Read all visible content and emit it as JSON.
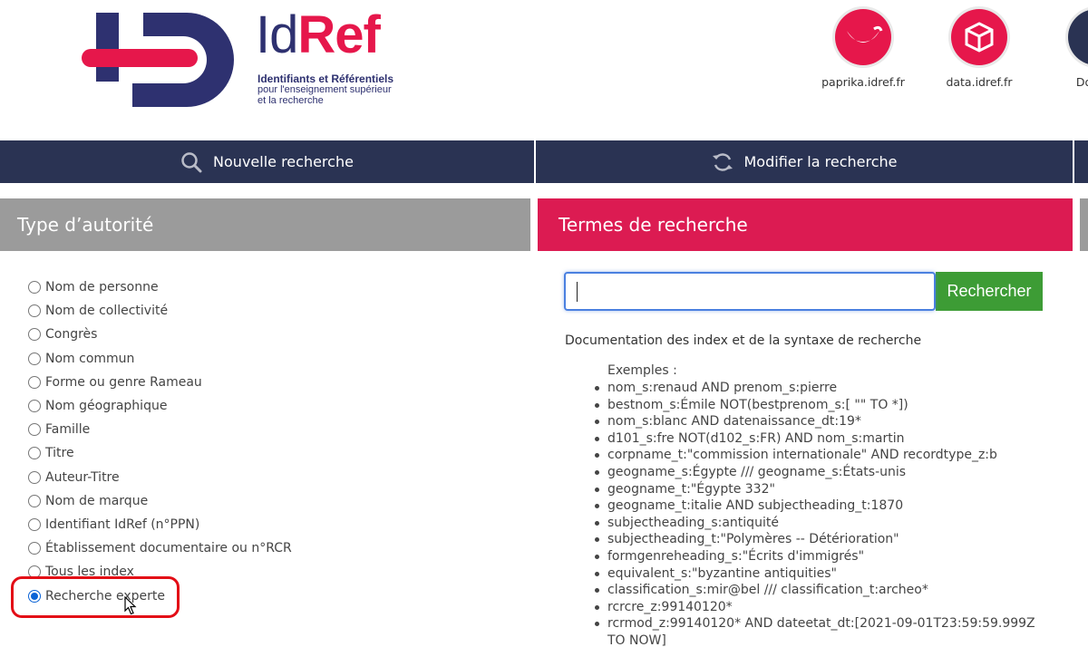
{
  "logo": {
    "id_text": "Id",
    "ref_text": "Ref",
    "subtitle_line1": "Identifiants et Référentiels",
    "subtitle_line2": "pour l'enseignement supérieur",
    "subtitle_line3": "et la recherche",
    "colors": {
      "navy": "#2e3170",
      "red": "#e6174b"
    }
  },
  "apps": [
    {
      "label": "paprika.idref.fr",
      "icon": "paprika-icon",
      "color": "#e6174b"
    },
    {
      "label": "data.idref.fr",
      "icon": "data-cube-icon",
      "color": "#e6174b"
    },
    {
      "label": "Docum",
      "icon": "documentation-icon",
      "color": "#2a3353"
    }
  ],
  "nav": {
    "new_search": "Nouvelle recherche",
    "modify_search": "Modifier la recherche",
    "color": "#2a3353"
  },
  "authority_panel": {
    "title": "Type d’autorité",
    "options": [
      {
        "label": "Nom de personne",
        "checked": false
      },
      {
        "label": "Nom de collectivité",
        "checked": false
      },
      {
        "label": "Congrès",
        "checked": false
      },
      {
        "label": "Nom commun",
        "checked": false
      },
      {
        "label": "Forme ou genre Rameau",
        "checked": false
      },
      {
        "label": "Nom géographique",
        "checked": false
      },
      {
        "label": "Famille",
        "checked": false
      },
      {
        "label": "Titre",
        "checked": false
      },
      {
        "label": "Auteur-Titre",
        "checked": false
      },
      {
        "label": "Nom de marque",
        "checked": false
      },
      {
        "label": "Identifiant IdRef (n°PPN)",
        "checked": false
      },
      {
        "label": "Établissement documentaire ou n°RCR",
        "checked": false
      },
      {
        "label": "Tous les index",
        "checked": false
      },
      {
        "label": "Recherche experte",
        "checked": true
      }
    ]
  },
  "search_panel": {
    "title": "Termes de recherche",
    "input_value": "",
    "button_label": "Rechercher",
    "doc_link": "Documentation des index et de la syntaxe de recherche",
    "examples_title": "Exemples :",
    "examples": [
      "nom_s:renaud AND prenom_s:pierre",
      "bestnom_s:Émile NOT(bestprenom_s:[ \"\" TO *])",
      "nom_s:blanc AND datenaissance_dt:19*",
      "d101_s:fre NOT(d102_s:FR) AND nom_s:martin",
      "corpname_t:\"commission internationale\" AND recordtype_z:b",
      "geogname_s:Égypte /// geogname_s:États-unis",
      "geogname_t:\"Égypte 332\"",
      "geogname_t:italie AND subjectheading_t:1870",
      "subjectheading_s:antiquité",
      "subjectheading_t:\"Polymères -- Détérioration\"",
      "formgenreheading_s:\"Écrits d'immigrés\"",
      "equivalent_s:\"byzantine antiquities\"",
      "classification_s:mir@bel /// classification_t:archeo*",
      "rcrcre_z:99140120*",
      "rcrmod_z:99140120* AND dateetat_dt:[2021-09-01T23:59:59.999Z TO NOW]"
    ],
    "colors": {
      "header": "#dc1b52",
      "button": "#3d9c35"
    }
  }
}
